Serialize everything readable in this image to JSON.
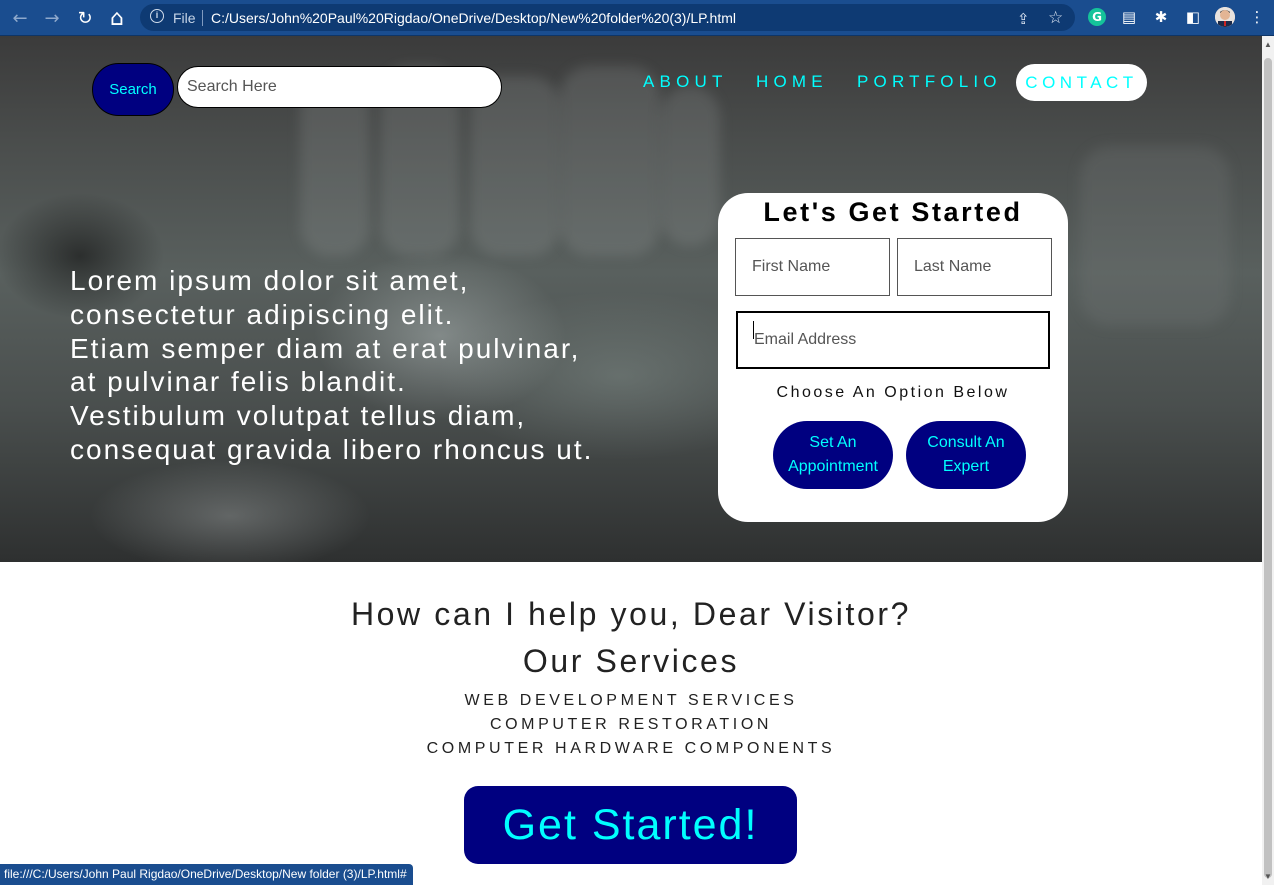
{
  "browser": {
    "back_icon": "←",
    "forward_icon": "→",
    "reload_icon": "↻",
    "home_icon": "⌂",
    "info_icon": "i",
    "file_label": "File",
    "url": "C:/Users/John%20Paul%20Rigdao/OneDrive/Desktop/New%20folder%20(3)/LP.html",
    "share_icon": "⇪",
    "star_icon": "☆",
    "grammarly_icon": "G",
    "save_icon": "▤",
    "extensions_icon": "✱",
    "sidepanel_icon": "◧",
    "menu_icon": "⋮"
  },
  "header": {
    "search_button": "Search",
    "search_placeholder": "Search Here",
    "nav": {
      "about": "ABOUT",
      "home": "HOME",
      "portfolio": "PORTFOLIO",
      "contact": "CONTACT"
    }
  },
  "hero": {
    "lines": [
      "Lorem ipsum dolor sit amet,",
      "consectetur adipiscing elit.",
      "Etiam semper diam at erat pulvinar,",
      "at pulvinar felis blandit.",
      "Vestibulum volutpat tellus diam,",
      "consequat gravida libero rhoncus ut."
    ]
  },
  "form": {
    "title": "Let's Get Started",
    "first_name_placeholder": "First Name",
    "last_name_placeholder": "Last Name",
    "email_placeholder": "Email Address",
    "choose_label": "Choose An Option Below",
    "appointment_line1": "Set An",
    "appointment_line2": "Appointment",
    "consult_line1": "Consult An",
    "consult_line2": "Expert"
  },
  "services": {
    "help_heading": "How can I help you, Dear Visitor?",
    "title": "Our Services",
    "items": [
      "WEB DEVELOPMENT SERVICES",
      "COMPUTER RESTORATION",
      "COMPUTER HARDWARE COMPONENTS"
    ]
  },
  "cta": {
    "label": "Get Started!"
  },
  "status_bar": {
    "text": "file:///C:/Users/John Paul Rigdao/OneDrive/Desktop/New folder (3)/LP.html#"
  },
  "colors": {
    "accent_navy": "#000080",
    "accent_cyan": "#00ffff",
    "browser_blue": "#1a4d8f"
  }
}
